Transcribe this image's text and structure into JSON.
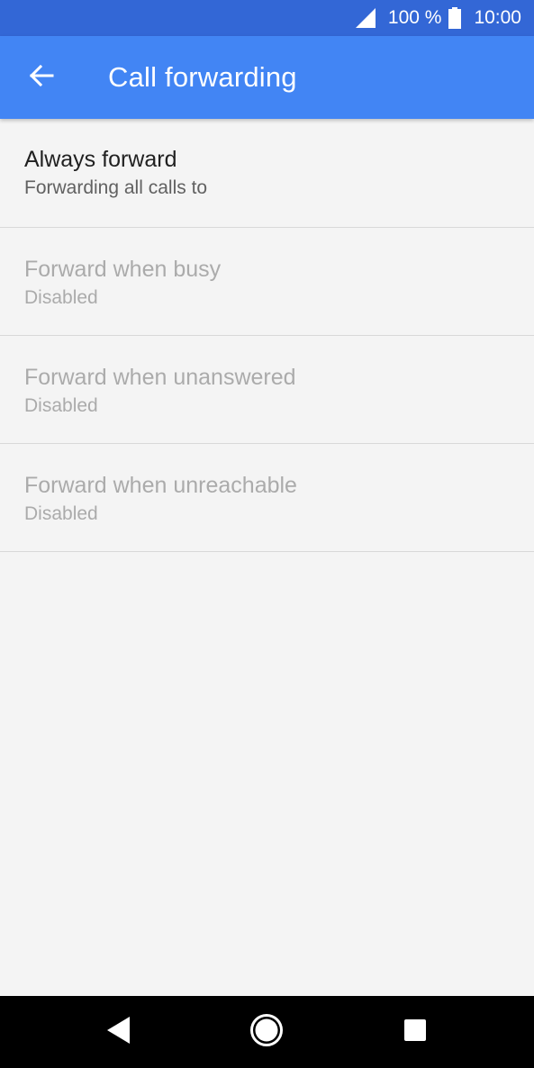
{
  "status_bar": {
    "battery_percent": "100 %",
    "time": "10:00",
    "icons": [
      "signal-icon",
      "battery-icon"
    ]
  },
  "app_bar": {
    "title": "Call forwarding",
    "back_icon": "back-arrow-icon"
  },
  "items": [
    {
      "title": "Always forward",
      "subtitle": "Forwarding all calls to",
      "enabled": true
    },
    {
      "title": "Forward when busy",
      "subtitle": "Disabled",
      "enabled": false
    },
    {
      "title": "Forward when unanswered",
      "subtitle": "Disabled",
      "enabled": false
    },
    {
      "title": "Forward when unreachable",
      "subtitle": "Disabled",
      "enabled": false
    }
  ],
  "nav_bar": {
    "icons": [
      "back-icon",
      "home-icon",
      "recents-icon"
    ]
  },
  "colors": {
    "status_bar": "#3367d6",
    "app_bar": "#4285f4",
    "background": "#f4f4f4",
    "disabled_text": "#ababab"
  }
}
